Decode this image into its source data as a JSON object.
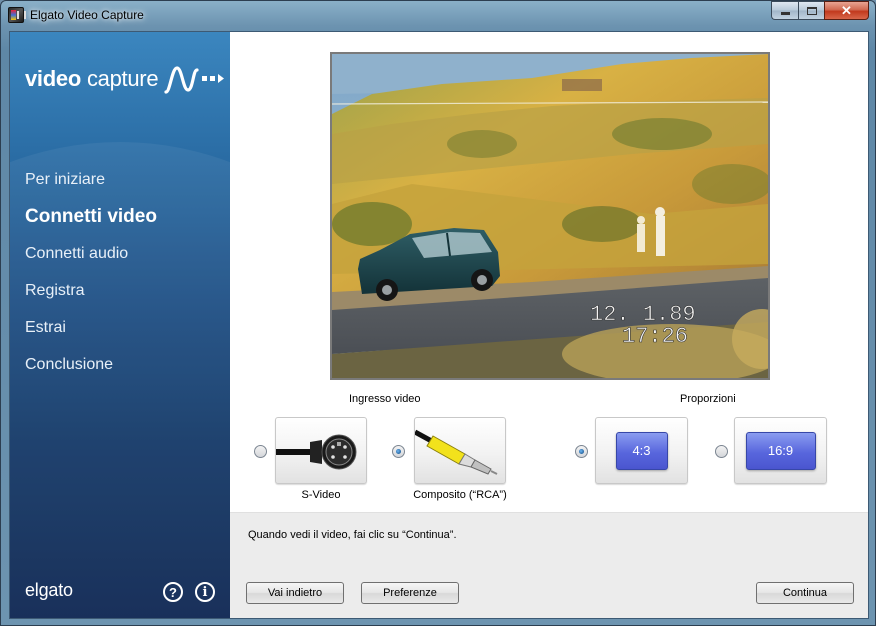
{
  "window": {
    "title": "Elgato Video Capture",
    "minimize_glyph": "",
    "close_glyph": "✕"
  },
  "sidebar": {
    "brand_bold": "video",
    "brand_regular": "capture",
    "items": [
      {
        "label": "Per iniziare",
        "active": false
      },
      {
        "label": "Connetti video",
        "active": true
      },
      {
        "label": "Connetti audio",
        "active": false
      },
      {
        "label": "Registra",
        "active": false
      },
      {
        "label": "Estrai",
        "active": false
      },
      {
        "label": "Conclusione",
        "active": false
      }
    ],
    "footer_brand": "elgato",
    "help_glyph": "?",
    "info_glyph": "i"
  },
  "preview": {
    "date_stamp": "12. 1.89",
    "time_stamp": "17:26"
  },
  "video_input": {
    "label": "Ingresso video",
    "options": [
      {
        "label": "S-Video",
        "selected": false
      },
      {
        "label": "Composito (“RCA”)",
        "selected": true
      }
    ]
  },
  "aspect": {
    "label": "Proporzioni",
    "options": [
      {
        "label": "4:3",
        "selected": true
      },
      {
        "label": "16:9",
        "selected": false
      }
    ]
  },
  "footer": {
    "instruction": "Quando vedi il video, fai clic su “Continua”.",
    "back_label": "Vai indietro",
    "prefs_label": "Preferenze",
    "next_label": "Continua"
  },
  "colors": {
    "sidebar_top": "#3b86bf",
    "sidebar_bottom": "#0b2450",
    "aspect_button": "#5866dd",
    "close_button": "#c2391d"
  },
  "icons": {
    "app": "elgato-app-icon",
    "svideo": "s-video-connector-icon",
    "rca": "rca-connector-icon",
    "help": "help-circle-icon",
    "info": "info-circle-icon"
  }
}
